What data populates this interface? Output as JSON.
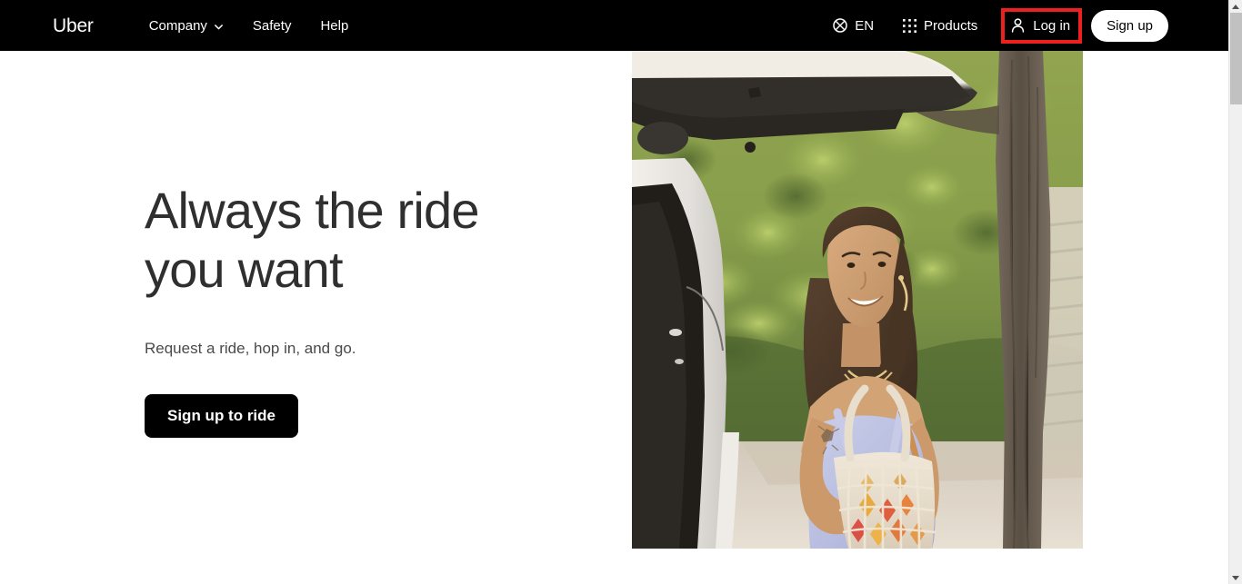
{
  "navbar": {
    "logo": "Uber",
    "links": [
      {
        "label": "Company",
        "icon": "chevron-down-icon",
        "has_chevron": true
      },
      {
        "label": "Safety",
        "has_chevron": false
      },
      {
        "label": "Help",
        "has_chevron": false
      }
    ],
    "language": {
      "label": "EN",
      "icon": "globe-icon"
    },
    "products": {
      "label": "Products",
      "icon": "grid-apps-icon"
    },
    "login": {
      "label": "Log in",
      "icon": "person-icon",
      "highlighted": true,
      "highlight_color": "#ee1f1f"
    },
    "signup": {
      "label": "Sign up"
    },
    "background_color": "#000000",
    "text_color": "#ffffff"
  },
  "hero": {
    "title_line1": "Always the ride",
    "title_line2": "you want",
    "subtitle": "Request a ride, hop in, and go.",
    "cta_label": "Sign up to ride",
    "title_color": "#2f2f2f",
    "cta_background": "#000000",
    "photo_alt": "Smiling woman with a woven tote bag standing beside an open car trunk under a tree"
  },
  "scrollbar": {
    "up_arrow": "scroll-up-arrow-icon",
    "down_arrow": "scroll-down-arrow-icon",
    "thumb_color": "#c1c1c1",
    "track_color": "#f0f0f0"
  }
}
